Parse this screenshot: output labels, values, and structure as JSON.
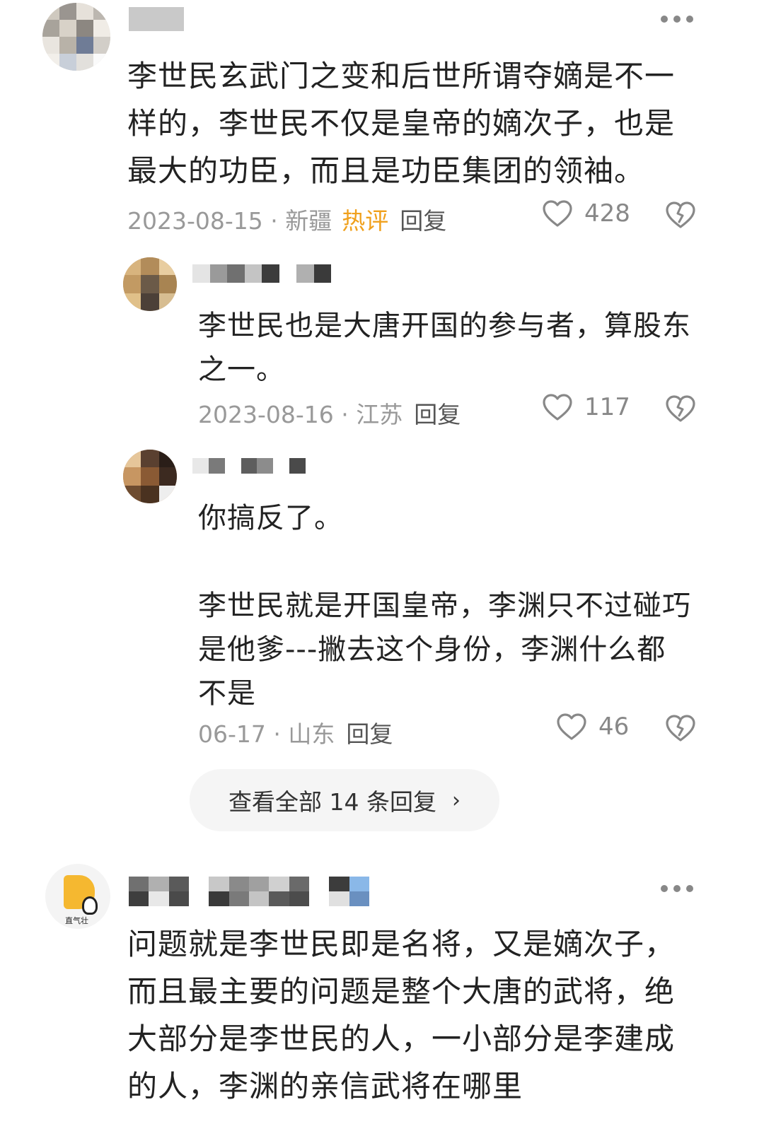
{
  "comments": [
    {
      "username": "",
      "text": "李世民玄武门之变和后世所谓夺嫡是不一样的，李世民不仅是皇帝的嫡次子，也是最大的功臣，而且是功臣集团的领袖。",
      "date": "2023-08-15",
      "location": "新疆",
      "hot_label": "热评",
      "reply_label": "回复",
      "likes": "428",
      "replies": [
        {
          "username": "",
          "text": "李世民也是大唐开国的参与者，算股东之一。",
          "date": "2023-08-16",
          "location": "江苏",
          "reply_label": "回复",
          "likes": "117"
        },
        {
          "username": "",
          "text": "你搞反了。\n\n李世民就是开国皇帝，李渊只不过碰巧是他爹---撇去这个身份，李渊什么都不是",
          "date": "06-17",
          "location": "山东",
          "reply_label": "回复",
          "likes": "46"
        }
      ],
      "view_all_label": "查看全部 14 条回复",
      "view_all_chevron": "›"
    },
    {
      "username": "",
      "avatar_text": "直气壮",
      "text": "问题就是李世民即是名将，又是嫡次子，而且最主要的问题是整个大唐的武将，绝大部分是李世民的人，一小部分是李建成的人，李渊的亲信武将在哪里"
    }
  ],
  "icons": {
    "like": "heart-icon",
    "dislike": "broken-heart-icon",
    "more": "more-dots-icon"
  },
  "colors": {
    "hot": "#f0a01c",
    "meta": "#999999",
    "text": "#222222"
  }
}
